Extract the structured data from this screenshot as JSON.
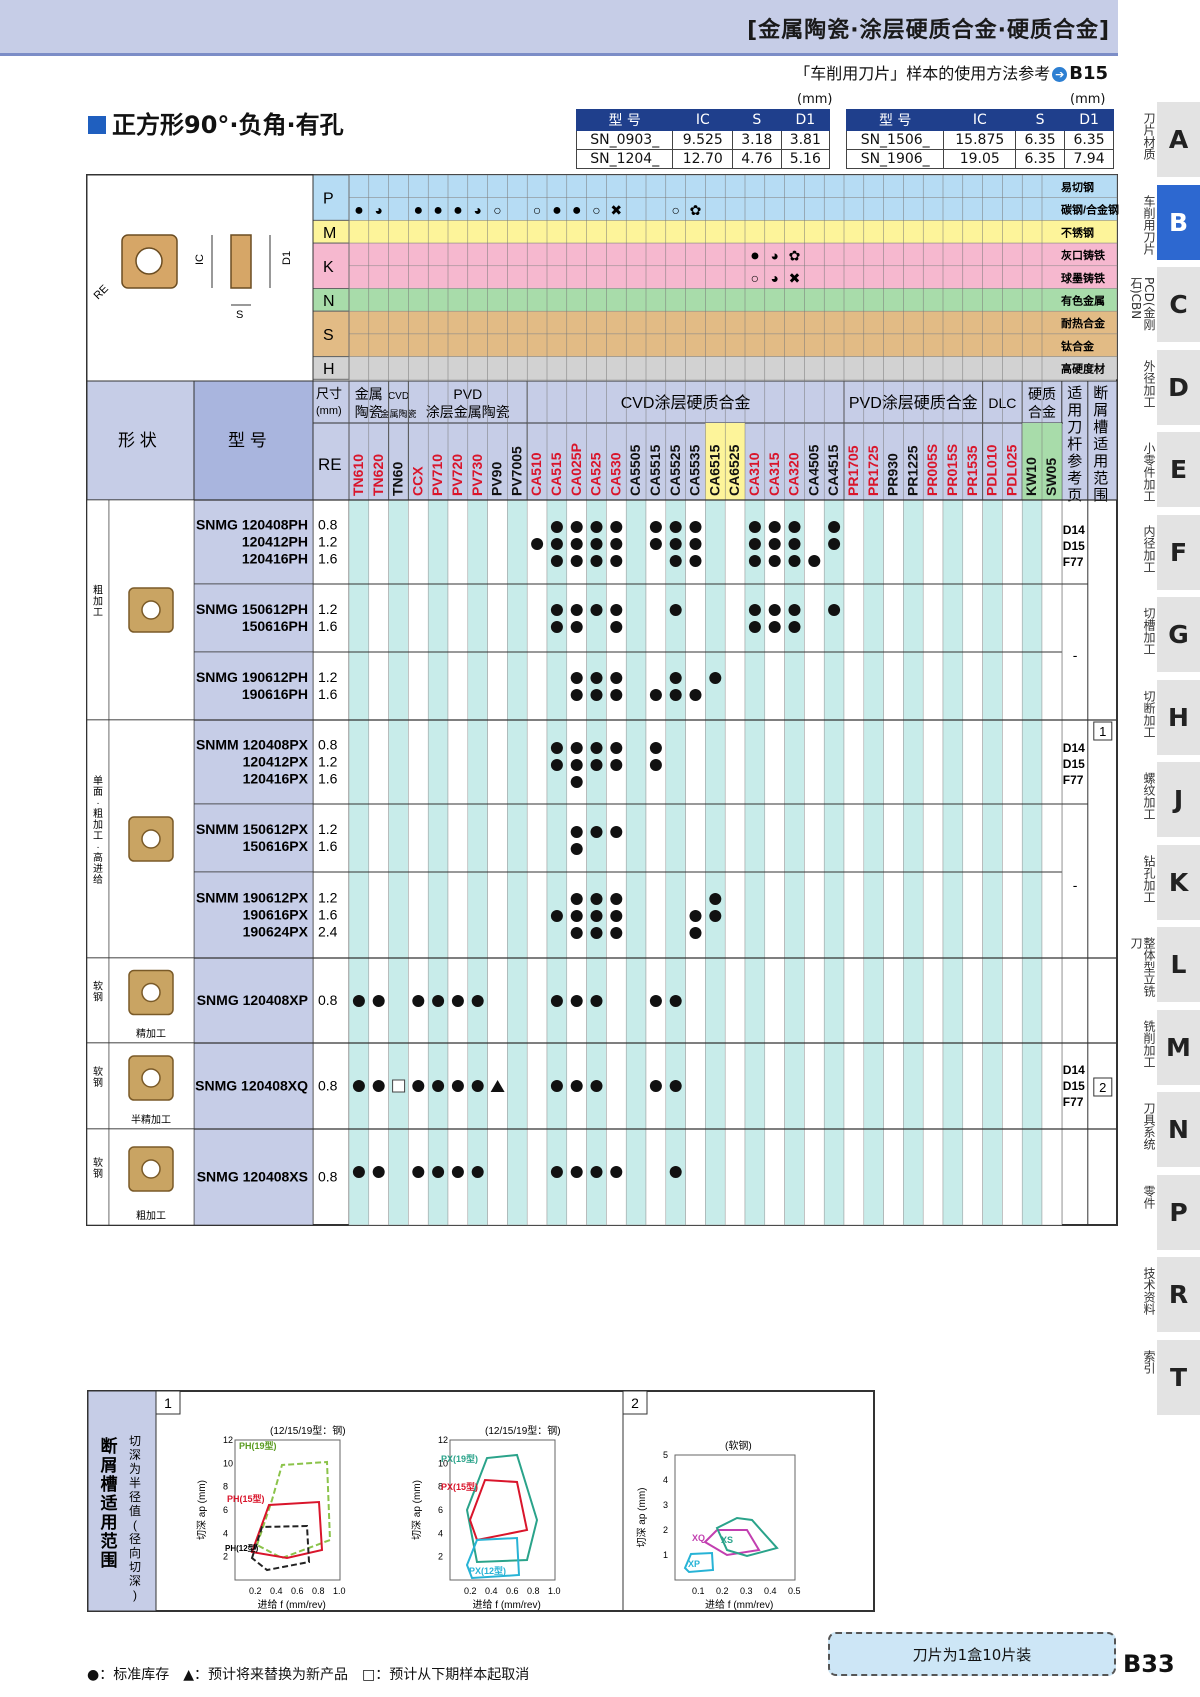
{
  "header": {
    "title": "[金属陶瓷·涂层硬质合金·硬质合金]",
    "ref_text": "「车削用刀片」样本的使用方法参考",
    "ref_page": "B15"
  },
  "section_title": "正方形90°·负角·有孔",
  "unit": "(mm)",
  "spec_headers": [
    "型 号",
    "IC",
    "S",
    "D1"
  ],
  "spec_left": [
    [
      "SN_0903_",
      "9.525",
      "3.18",
      "3.81"
    ],
    [
      "SN_1204_",
      "12.70",
      "4.76",
      "5.16"
    ]
  ],
  "spec_right": [
    [
      "SN_1506_",
      "15.875",
      "6.35",
      "6.35"
    ],
    [
      "SN_1906_",
      "19.05",
      "6.35",
      "7.94"
    ]
  ],
  "materials": [
    {
      "code": "P",
      "labels": [
        "易切钢",
        "碳钢/合金钢"
      ],
      "color": "#b6dcf4"
    },
    {
      "code": "M",
      "labels": [
        "不锈钢"
      ],
      "color": "#fdf49a"
    },
    {
      "code": "K",
      "labels": [
        "灰口铸铁",
        "球墨铸铁"
      ],
      "color": "#f6b8cf"
    },
    {
      "code": "N",
      "labels": [
        "有色金属"
      ],
      "color": "#a8dcaa"
    },
    {
      "code": "S",
      "labels": [
        "耐热合金",
        "钛合金"
      ],
      "color": "#e2bb85"
    },
    {
      "code": "H",
      "labels": [
        "高硬度材"
      ],
      "color": "#d2d2d2"
    }
  ],
  "diagram_labels": {
    "ic": "IC",
    "d1": "D1",
    "s": "S",
    "re": "RE"
  },
  "group_headers": {
    "size": "尺寸\n(mm)",
    "cermet": "金属\n陶瓷",
    "cbn": "CVD\n金属陶瓷",
    "pvd_cermet": "PVD\n涂层金属陶瓷",
    "cvd": "CVD涂层硬质合金",
    "pvd": "PVD涂层硬质合金",
    "dlc": "DLC",
    "carbide": "硬质\n合金",
    "holder": "适用刀杆参考页",
    "breaker": "断屑槽适用范围"
  },
  "shape_label": "形 状",
  "model_label": "型 号",
  "re_label": "RE",
  "grades": [
    "TN610",
    "TN620",
    "TN60",
    "CCX",
    "PV710",
    "PV720",
    "PV730",
    "PV90",
    "PV7005",
    "CA510",
    "CA515",
    "CA025P",
    "CA525",
    "CA530",
    "CA5505",
    "CA5515",
    "CA5525",
    "CA5535",
    "CA6515",
    "CA6525",
    "CA310",
    "CA315",
    "CA320",
    "CA4505",
    "CA4515",
    "PR1705",
    "PR1725",
    "PR930",
    "PR1225",
    "PR005S",
    "PR015S",
    "PR1535",
    "PDL010",
    "PDL025",
    "KW10",
    "SW05"
  ],
  "groups": [
    {
      "side": "粗加工",
      "rows": [
        {
          "models": [
            "SNMG 120408PH",
            "120412PH",
            "120416PH"
          ],
          "re": [
            "0.8",
            "1.2",
            "1.6"
          ]
        },
        {
          "models": [
            "SNMG 150612PH",
            "150616PH"
          ],
          "re": [
            "1.2",
            "1.6"
          ]
        },
        {
          "models": [
            "SNMG 190612PH",
            "190616PH"
          ],
          "re": [
            "1.2",
            "1.6"
          ]
        }
      ],
      "holder": "D14\nD15\nF77",
      "breaker": "1"
    },
    {
      "side": "单面·粗加工·高进给",
      "rows": [
        {
          "models": [
            "SNMM 120408PX",
            "120412PX",
            "120416PX"
          ],
          "re": [
            "0.8",
            "1.2",
            "1.6"
          ]
        },
        {
          "models": [
            "SNMM 150612PX",
            "150616PX"
          ],
          "re": [
            "1.2",
            "1.6"
          ]
        },
        {
          "models": [
            "SNMM 190612PX",
            "190616PX",
            "190624PX"
          ],
          "re": [
            "1.2",
            "1.6",
            "2.4"
          ]
        }
      ],
      "holder": "D14\nD15\nF77",
      "holder2": "-"
    },
    {
      "side": "软钢",
      "sub": "精加工",
      "rows": [
        {
          "models": [
            "SNMG 120408XP"
          ],
          "re": [
            "0.8"
          ]
        }
      ]
    },
    {
      "side": "软钢",
      "sub": "半精加工",
      "rows": [
        {
          "models": [
            "SNMG 120408XQ"
          ],
          "re": [
            "0.8"
          ]
        }
      ],
      "holder": "D14\nD15\nF77",
      "breaker": "2"
    },
    {
      "side": "软钢",
      "sub": "粗加工",
      "rows": [
        {
          "models": [
            "SNMG 120408XS"
          ],
          "re": [
            "0.8"
          ]
        }
      ]
    }
  ],
  "holder_dash": "-",
  "bottom": {
    "title": "断屑槽适用范围",
    "subtitle": "切深为半径值(径向切深)",
    "box1": "1",
    "box2": "2",
    "chart1_title": "(12/15/19型：钢)",
    "chart2_title": "(12/15/19型：钢)",
    "chart3_title": "(软钢)",
    "xlabel": "进给 f (mm/rev)",
    "ylabel": "切深 ap (mm)",
    "c1_labels": [
      "PH(19型)",
      "PH(15型)",
      "PH(12型)"
    ],
    "c2_labels": [
      "PX(19型)",
      "PX(15型)",
      "PX(12型)"
    ],
    "c3_labels": [
      "XQ",
      "XS",
      "XP"
    ],
    "yt1": [
      "12",
      "10",
      "8",
      "6",
      "4",
      "2"
    ],
    "xt1": [
      "0.2",
      "0.4",
      "0.6",
      "0.8",
      "1.0"
    ],
    "yt3": [
      "5",
      "4",
      "3",
      "2",
      "1"
    ],
    "xt3": [
      "0.1",
      "0.2",
      "0.3",
      "0.4",
      "0.5"
    ]
  },
  "legend": "●：标准库存　▲：预计将来替换为新产品　□：预计从下期样本起取消",
  "box_note": "刀片为1盒10片装",
  "page_number": "B33",
  "side_tabs": [
    {
      "letter": "A",
      "label": "刀片材质"
    },
    {
      "letter": "B",
      "label": "车削用刀片"
    },
    {
      "letter": "C",
      "label": "PCD(金刚石)CBN"
    },
    {
      "letter": "D",
      "label": "外径加工"
    },
    {
      "letter": "E",
      "label": "小零件加工"
    },
    {
      "letter": "F",
      "label": "内径加工"
    },
    {
      "letter": "G",
      "label": "切槽加工"
    },
    {
      "letter": "H",
      "label": "切断加工"
    },
    {
      "letter": "J",
      "label": "螺纹加工"
    },
    {
      "letter": "K",
      "label": "钻孔加工"
    },
    {
      "letter": "L",
      "label": "整体型立铣刀"
    },
    {
      "letter": "M",
      "label": "铣削加工"
    },
    {
      "letter": "N",
      "label": "刀具系统"
    },
    {
      "letter": "P",
      "label": "零件"
    },
    {
      "letter": "R",
      "label": "技术资料"
    },
    {
      "letter": "T",
      "label": "索引"
    }
  ],
  "colors": {
    "accent": "#2d68d0",
    "header": "#c6cde7",
    "cvd_col": "#c8ecea",
    "brand_blue": "#1f3f8c"
  }
}
